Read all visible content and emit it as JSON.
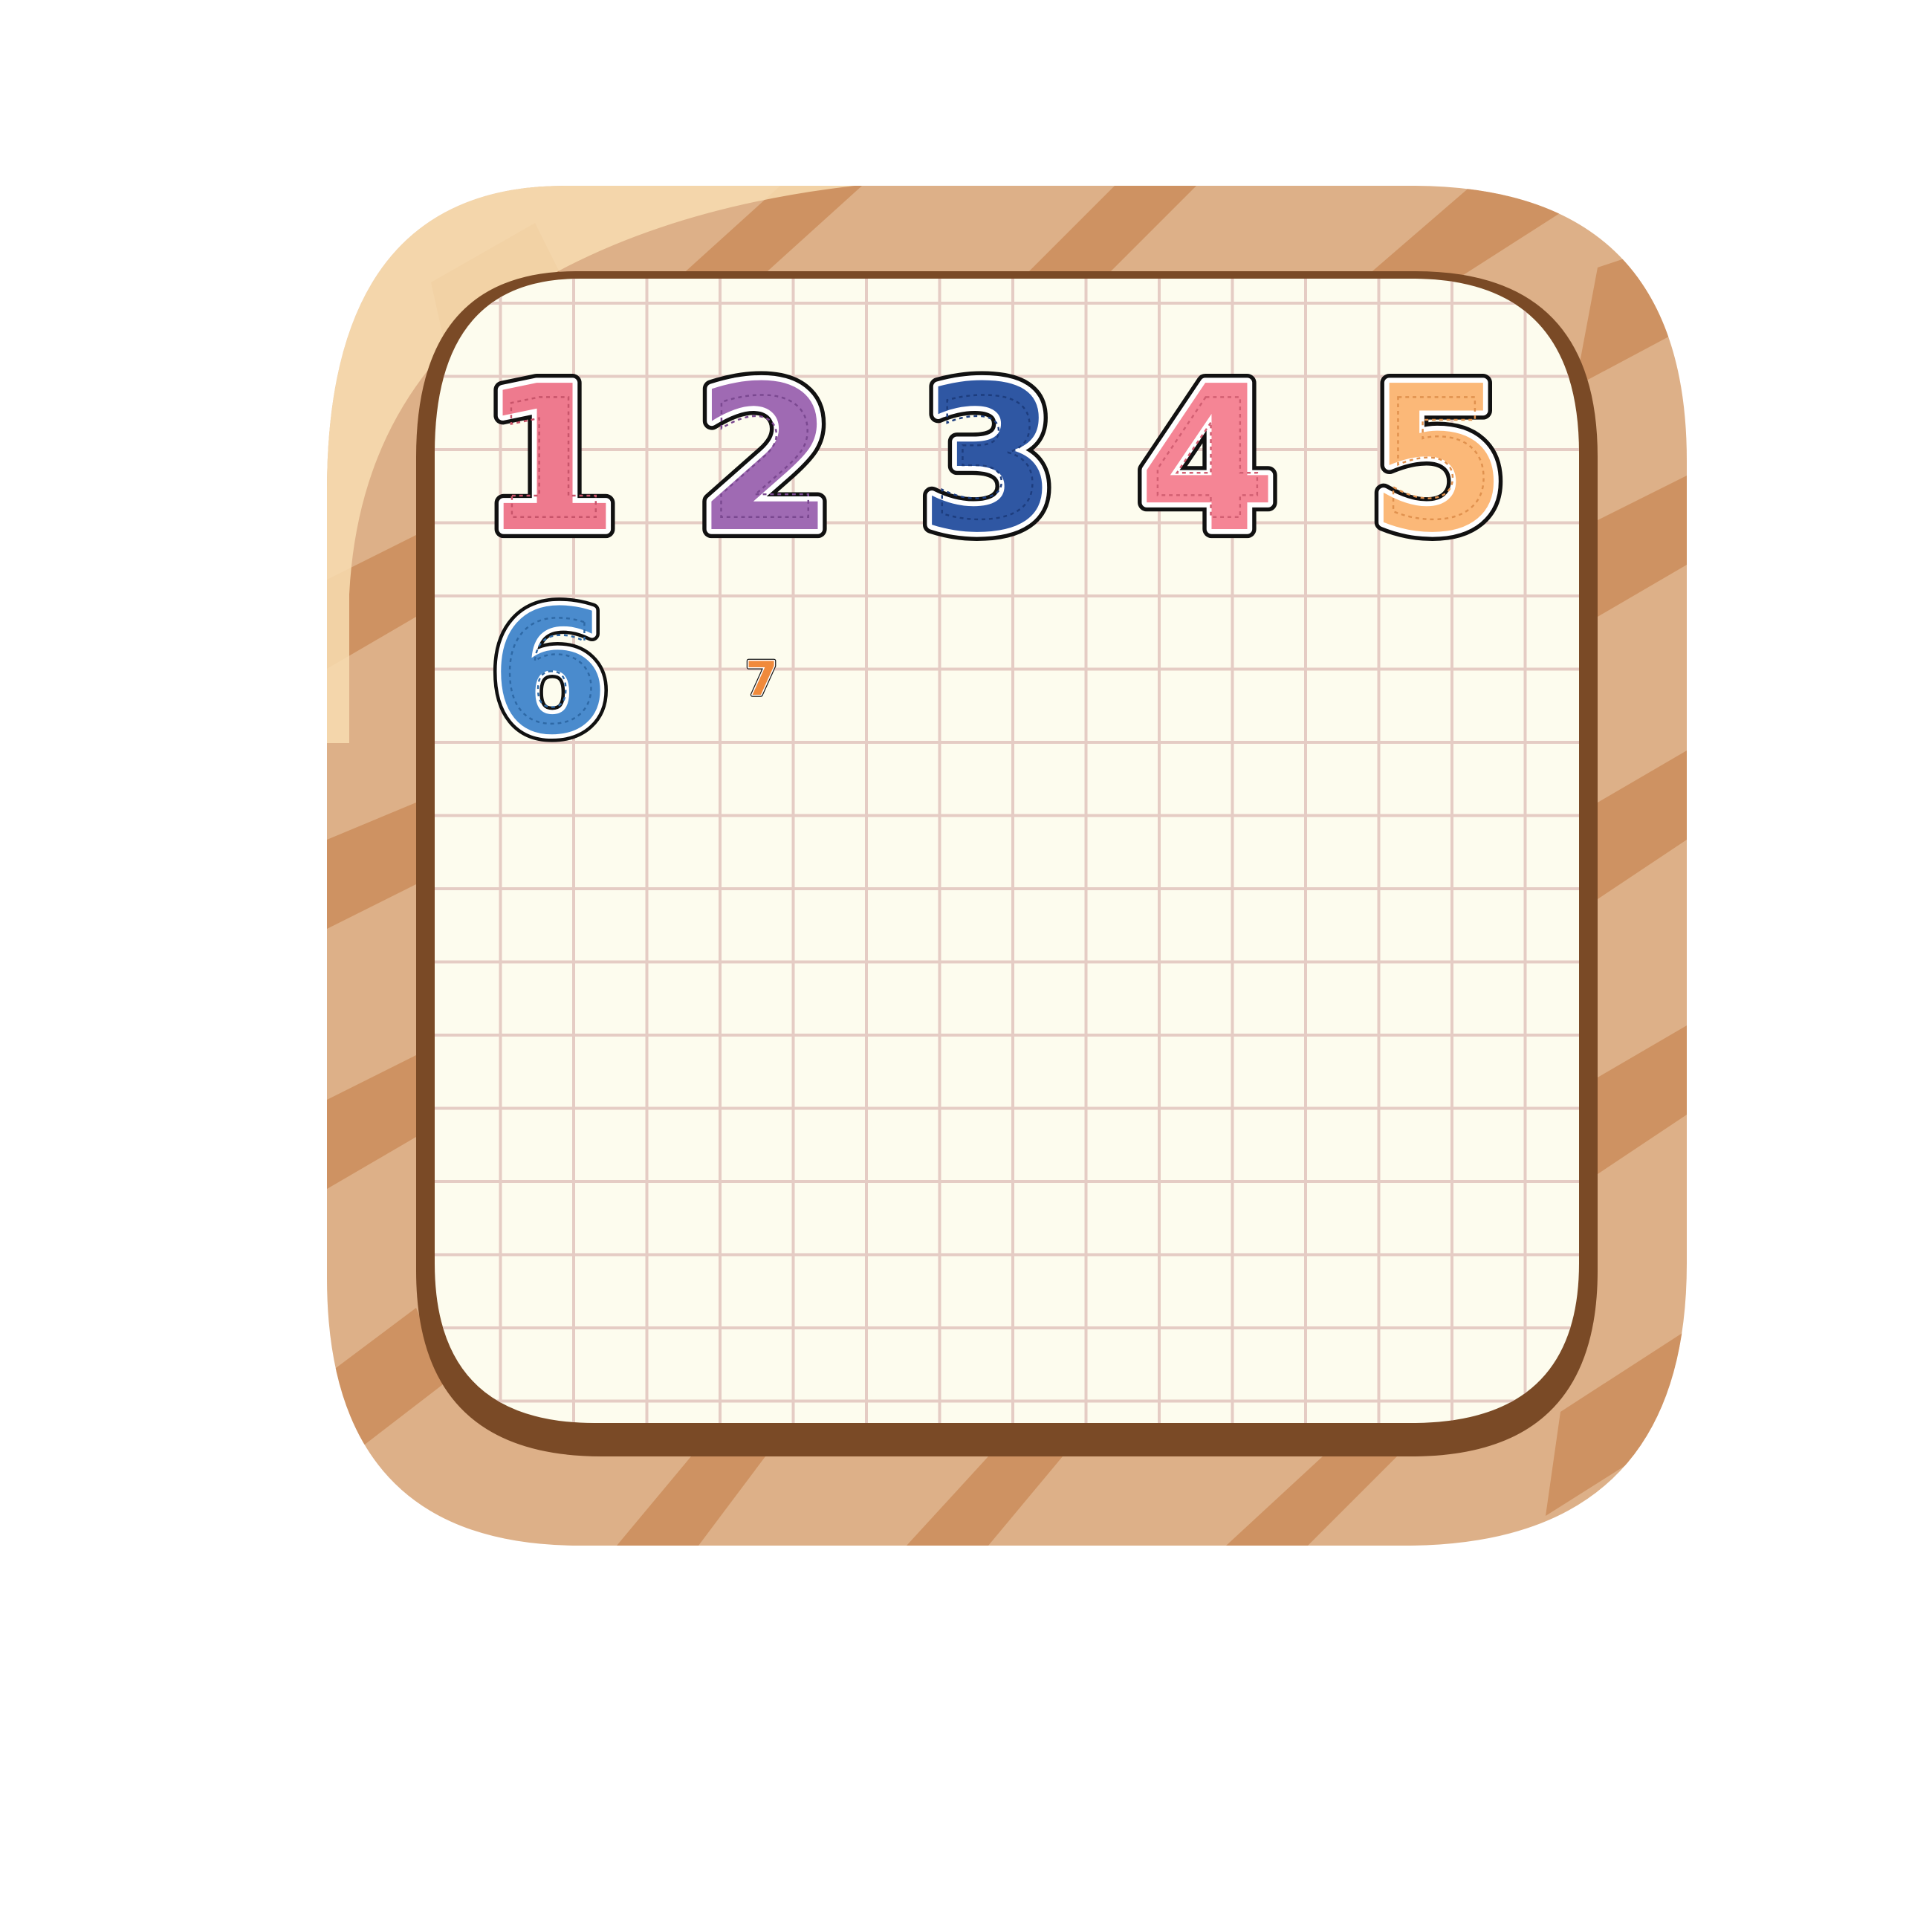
{
  "board": {
    "frame_light": "#DDB088",
    "frame_stripe": "#CE9262",
    "frame_highlight": "#F8DDB1",
    "frame_inner_edge": "#7A4A26",
    "paper": "#FDFCEE",
    "grid_line": "#E5CCC4"
  },
  "numbers": [
    {
      "label": "1",
      "color": "#EE7A8E",
      "stitch": "#C8546A"
    },
    {
      "label": "2",
      "color": "#9F6AB3",
      "stitch": "#7A4890"
    },
    {
      "label": "3",
      "color": "#2F57A3",
      "stitch": "#1D3D7E"
    },
    {
      "label": "4",
      "color": "#F58595",
      "stitch": "#D25F72"
    },
    {
      "label": "5",
      "color": "#FBB878",
      "stitch": "#E0914E"
    },
    {
      "label": "6",
      "color": "#4A8BCD",
      "stitch": "#2E69A6"
    },
    {
      "label": "7",
      "color": "#F08A3C",
      "stitch": "#C9661F"
    }
  ]
}
